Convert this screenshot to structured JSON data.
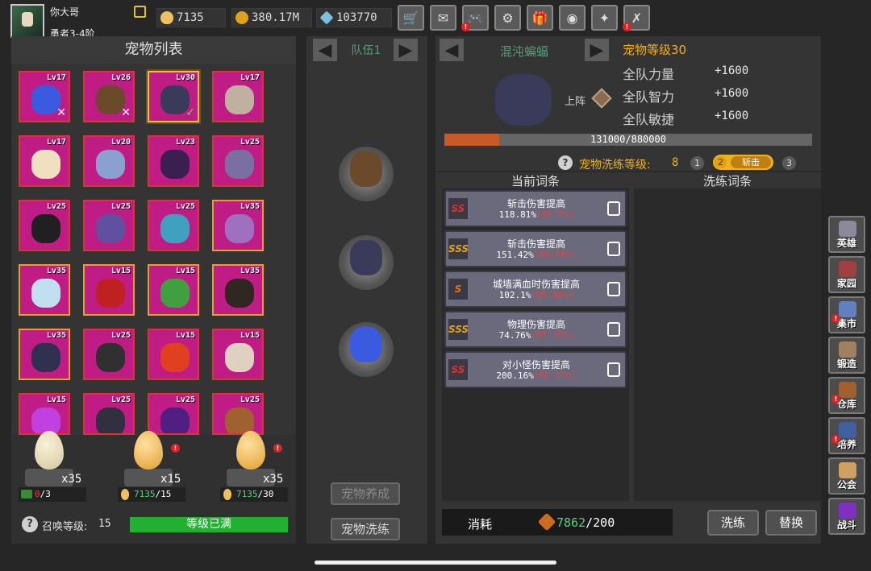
{
  "player": {
    "name": "你大哥",
    "rank": "勇者3-4阶"
  },
  "resources": [
    {
      "name": "egg",
      "value": "7135",
      "color": "#f0c060"
    },
    {
      "name": "coin",
      "value": "380.17M",
      "color": "#e0a020"
    },
    {
      "name": "diamond",
      "value": "103770",
      "color": "#7ac0e0"
    }
  ],
  "topButtons": [
    {
      "icon": "cart-icon",
      "glyph": "🛒",
      "badge": ""
    },
    {
      "icon": "mail-icon",
      "glyph": "✉",
      "badge": ""
    },
    {
      "icon": "gamepad-icon",
      "glyph": "🎮",
      "badge": "!"
    },
    {
      "icon": "gear-icon",
      "glyph": "⚙",
      "badge": ""
    },
    {
      "icon": "gift-icon",
      "glyph": "🎁",
      "badge": ""
    },
    {
      "icon": "wheel-icon",
      "glyph": "◉",
      "badge": ""
    },
    {
      "icon": "rune-icon",
      "glyph": "✦",
      "badge": ""
    },
    {
      "icon": "tools-icon",
      "glyph": "✗",
      "badge": "!"
    }
  ],
  "petList": {
    "title": "宠物列表",
    "pets": [
      {
        "lv": "Lv17",
        "color": "#3a5adf",
        "border": "red",
        "mark": "✕"
      },
      {
        "lv": "Lv26",
        "color": "#6a4a2a",
        "border": "red",
        "mark": "✕"
      },
      {
        "lv": "Lv30",
        "color": "#3a3a5a",
        "border": "sel",
        "mark": "✓"
      },
      {
        "lv": "Lv17",
        "color": "#c0b0a0",
        "border": "red",
        "mark": ""
      },
      {
        "lv": "Lv17",
        "color": "#f0e0c0",
        "border": "red",
        "mark": ""
      },
      {
        "lv": "Lv20",
        "color": "#8aa0d0",
        "border": "red",
        "mark": ""
      },
      {
        "lv": "Lv23",
        "color": "#3a2050",
        "border": "red",
        "mark": ""
      },
      {
        "lv": "Lv25",
        "color": "#7a70a0",
        "border": "red",
        "mark": ""
      },
      {
        "lv": "Lv25",
        "color": "#202020",
        "border": "red",
        "mark": ""
      },
      {
        "lv": "Lv25",
        "color": "#6050a0",
        "border": "red",
        "mark": ""
      },
      {
        "lv": "Lv25",
        "color": "#40a0c0",
        "border": "red",
        "mark": ""
      },
      {
        "lv": "Lv35",
        "color": "#a070c0",
        "border": "gold",
        "mark": ""
      },
      {
        "lv": "Lv35",
        "color": "#c0e0f0",
        "border": "gold",
        "mark": ""
      },
      {
        "lv": "Lv15",
        "color": "#c02020",
        "border": "gold",
        "mark": ""
      },
      {
        "lv": "Lv15",
        "color": "#40a040",
        "border": "gold",
        "mark": ""
      },
      {
        "lv": "Lv35",
        "color": "#302820",
        "border": "gold",
        "mark": ""
      },
      {
        "lv": "Lv35",
        "color": "#303050",
        "border": "gold",
        "mark": ""
      },
      {
        "lv": "Lv25",
        "color": "#303030",
        "border": "red",
        "mark": ""
      },
      {
        "lv": "Lv15",
        "color": "#e04020",
        "border": "red",
        "mark": ""
      },
      {
        "lv": "Lv15",
        "color": "#e0d0c0",
        "border": "red",
        "mark": ""
      },
      {
        "lv": "Lv15",
        "color": "#c040e0",
        "border": "red",
        "mark": ""
      },
      {
        "lv": "Lv25",
        "color": "#303040",
        "border": "red",
        "mark": ""
      },
      {
        "lv": "Lv25",
        "color": "#502080",
        "border": "red",
        "mark": ""
      },
      {
        "lv": "Lv25",
        "color": "#a06030",
        "border": "red",
        "mark": ""
      }
    ]
  },
  "summon": {
    "eggs": [
      {
        "count": "x35",
        "costIcon": "video",
        "cost": "0",
        "max": "/3",
        "badge": ""
      },
      {
        "count": "x15",
        "costIcon": "egg",
        "cost": "7135",
        "max": "/15",
        "badge": "!"
      },
      {
        "count": "x35",
        "costIcon": "egg",
        "cost": "7135",
        "max": "/30",
        "badge": "!"
      }
    ],
    "levelLabel": "召唤等级:",
    "level": "15",
    "status": "等级已满"
  },
  "team": {
    "label": "队伍1",
    "slots": [
      {
        "color": "#6a4a2a"
      },
      {
        "color": "#3a3a5a"
      },
      {
        "color": "#3a5adf"
      }
    ],
    "btnTrain": "宠物养成",
    "btnRefine": "宠物洗练"
  },
  "pet": {
    "name": "混沌蝙蝠",
    "levelText": "宠物等级30",
    "deploy": "上阵",
    "exp": "131000/880000",
    "expFraction": 0.149,
    "stats": [
      {
        "label": "全队力量",
        "value": "+1600"
      },
      {
        "label": "全队智力",
        "value": "+1600"
      },
      {
        "label": "全队敏捷",
        "value": "+1600"
      }
    ]
  },
  "refine": {
    "levelLabel": "宠物洗练等级:",
    "level": "8",
    "tabs": [
      {
        "num": "1",
        "label": ""
      },
      {
        "num": "2",
        "label": "斩击"
      },
      {
        "num": "3",
        "label": ""
      }
    ],
    "currentHeader": "当前词条",
    "refineHeader": "洗练词条",
    "entries": [
      {
        "rank": "SS",
        "name": "斩击伤害提高",
        "value": "118.81%",
        "max": "(95.2%)"
      },
      {
        "rank": "SSS",
        "name": "斩击伤害提高",
        "value": "151.42%",
        "max": "(98.58%)"
      },
      {
        "rank": "S",
        "name": "城墙满血时伤害提高",
        "value": "102.1%",
        "max": "(85.08%)"
      },
      {
        "rank": "SSS",
        "name": "物理伤害提高",
        "value": "74.76%",
        "max": "(97.35%)"
      },
      {
        "rank": "SS",
        "name": "对小怪伤害提高",
        "value": "200.16%",
        "max": "(96.23%)"
      }
    ],
    "costLabel": "消耗",
    "costValue": "7862",
    "costMax": "/200",
    "btnRefine": "洗练",
    "btnReplace": "替换"
  },
  "sideNav": [
    {
      "label": "英雄",
      "icon": "helmet-icon",
      "color": "#8a8a9a",
      "badge": ""
    },
    {
      "label": "家园",
      "icon": "castle-icon",
      "color": "#a04040",
      "badge": ""
    },
    {
      "label": "集市",
      "icon": "market-icon",
      "color": "#6080c0",
      "badge": "!"
    },
    {
      "label": "锻造",
      "icon": "anvil-icon",
      "color": "#a08060",
      "badge": ""
    },
    {
      "label": "仓库",
      "icon": "chest-icon",
      "color": "#a06030",
      "badge": "!"
    },
    {
      "label": "培养",
      "icon": "flask-icon",
      "color": "#4060a0",
      "badge": "!"
    },
    {
      "label": "公会",
      "icon": "guild-icon",
      "color": "#d0a060",
      "badge": ""
    },
    {
      "label": "战斗",
      "icon": "portal-icon",
      "color": "#8030c0",
      "badge": ""
    }
  ]
}
